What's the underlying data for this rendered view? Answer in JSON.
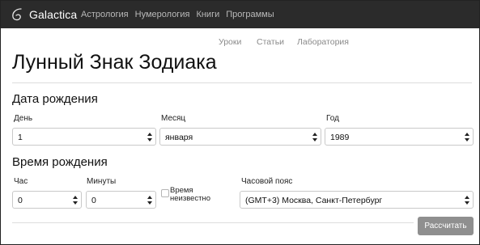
{
  "navbar": {
    "brand": "Galactica",
    "items": [
      "Астрология",
      "Нумерология",
      "Книги",
      "Программы"
    ]
  },
  "subnav": {
    "items": [
      "Уроки",
      "Статьи",
      "Лаборатория"
    ]
  },
  "page": {
    "title": "Лунный Знак Зодиака"
  },
  "birth_date": {
    "title": "Дата рождения",
    "day": {
      "label": "День",
      "value": "1"
    },
    "month": {
      "label": "Месяц",
      "value": "января"
    },
    "year": {
      "label": "Год",
      "value": "1989"
    }
  },
  "birth_time": {
    "title": "Время рождения",
    "hour": {
      "label": "Час",
      "value": "0"
    },
    "minutes": {
      "label": "Минуты",
      "value": "0"
    },
    "unknown_time": {
      "label_line1": "Время",
      "label_line2": "неизвестно",
      "checked": false
    },
    "timezone": {
      "label": "Часовой пояс",
      "value": "(GMT+3) Москва, Санкт-Петербург"
    }
  },
  "actions": {
    "calculate_label": "Рассчитать"
  },
  "colors": {
    "navbar_bg": "#2b2b2b",
    "button_bg": "#8f8f8f"
  }
}
